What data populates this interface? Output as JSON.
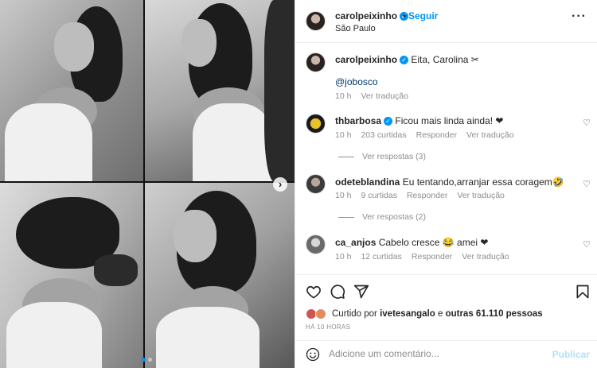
{
  "post": {
    "author": "carolpeixinho",
    "follow_dot": "•",
    "follow_label": "Seguir",
    "location": "São Paulo",
    "more_label": "···",
    "next_label": "›"
  },
  "caption": {
    "username": "carolpeixinho",
    "text": "Eita, Carolina ✂",
    "mention": "@jobosco",
    "time": "10 h",
    "translate": "Ver tradução"
  },
  "comments": [
    {
      "username": "thbarbosa",
      "text": "Ficou mais linda ainda! ❤",
      "time": "10 h",
      "likes": "203 curtidas",
      "reply": "Responder",
      "translate": "Ver tradução",
      "replies": "Ver respostas (3)"
    },
    {
      "username": "odeteblandina",
      "text": "Eu tentando,arranjar essa coragem🤣",
      "time": "10 h",
      "likes": "9 curtidas",
      "reply": "Responder",
      "translate": "Ver tradução",
      "replies": "Ver respostas (2)"
    },
    {
      "username": "ca_anjos",
      "text": "Cabelo cresce 😂 amei ❤",
      "time": "10 h",
      "likes": "12 curtidas",
      "reply": "Responder",
      "translate": "Ver tradução"
    }
  ],
  "likes": {
    "prefix": "Curtido por",
    "user": "ivetesangalo",
    "connector": "e",
    "others": "outras 61.110 pessoas"
  },
  "time_ago": "HÁ 10 HORAS",
  "composer": {
    "placeholder": "Adicione um comentário...",
    "post_label": "Publicar"
  },
  "carousel": {
    "total_slides": 2,
    "active_slide": 1
  },
  "colors": {
    "accent": "#0095f6",
    "muted": "#8e8e8e",
    "post_disabled": "#b2dffc"
  },
  "icons": [
    "heart-icon",
    "comment-icon",
    "share-icon",
    "bookmark-icon",
    "emoji-icon",
    "verified-icon",
    "chevron-right-icon"
  ]
}
